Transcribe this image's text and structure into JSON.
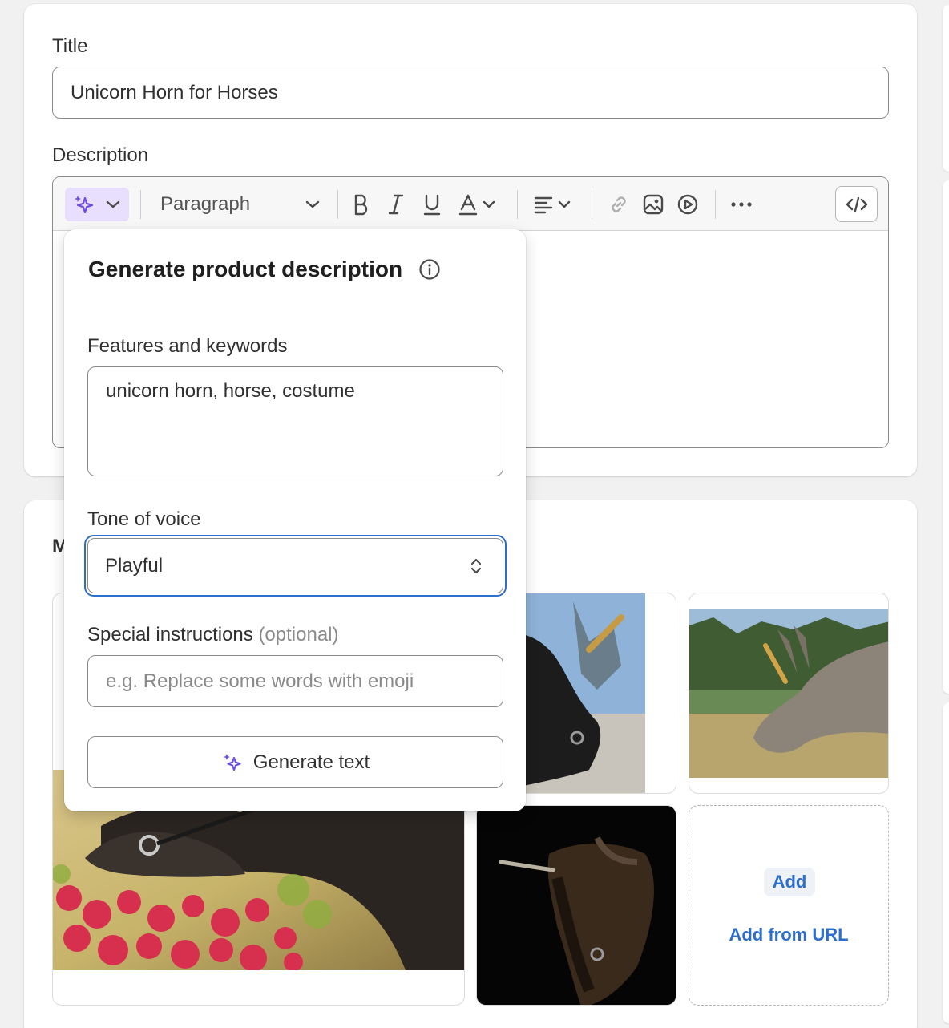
{
  "title_section": {
    "label": "Title",
    "value": "Unicorn Horn for Horses"
  },
  "description_section": {
    "label": "Description",
    "toolbar": {
      "paragraph_label": "Paragraph",
      "icons": [
        "magic-sparkle-icon",
        "chevron-down-icon",
        "bold-icon",
        "italic-icon",
        "underline-icon",
        "text-color-icon",
        "align-icon",
        "link-icon",
        "image-icon",
        "video-icon",
        "more-icon",
        "code-icon"
      ]
    }
  },
  "media_section": {
    "label": "M",
    "add_label": "Add",
    "add_from_url_label": "Add from URL"
  },
  "popover": {
    "title": "Generate product description",
    "features_label": "Features and keywords",
    "features_value": "unicorn horn, horse, costume",
    "tone_label": "Tone of voice",
    "tone_value": "Playful",
    "special_label": "Special instructions",
    "special_optional": "(optional)",
    "special_placeholder": "e.g. Replace some words with emoji",
    "generate_button": "Generate text"
  },
  "colors": {
    "accent_blue": "#2c6ecb",
    "ai_purple": "#6c4ee3",
    "ai_button_bg": "#e8defd"
  }
}
